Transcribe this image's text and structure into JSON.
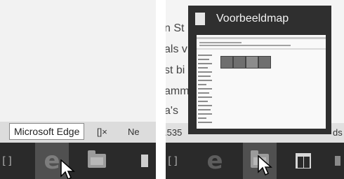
{
  "left_panel": {
    "tooltip": "Microsoft Edge",
    "status_fragments": [
      "[]×",
      "Ne"
    ],
    "taskbar_edge_letter": "e",
    "taskbar_side_glyph": "[]"
  },
  "right_panel": {
    "thumbnail_title": "Voorbeeldmap",
    "behind_text": [
      "n St",
      "als v",
      "st bi",
      "amm",
      "a's"
    ],
    "status_number": ".535",
    "status_tail": "ds",
    "taskbar_edge_letter": "e",
    "taskbar_side_glyph": "[]"
  },
  "icons": [
    "edge-icon",
    "file-explorer-icon",
    "store-icon",
    "task-view-icon",
    "mouse-pointer-icon"
  ],
  "colors": {
    "taskbar": "#2a2a2a",
    "thumbnail": "#2f2f2f",
    "tooltip_border": "#8a8a8a"
  }
}
